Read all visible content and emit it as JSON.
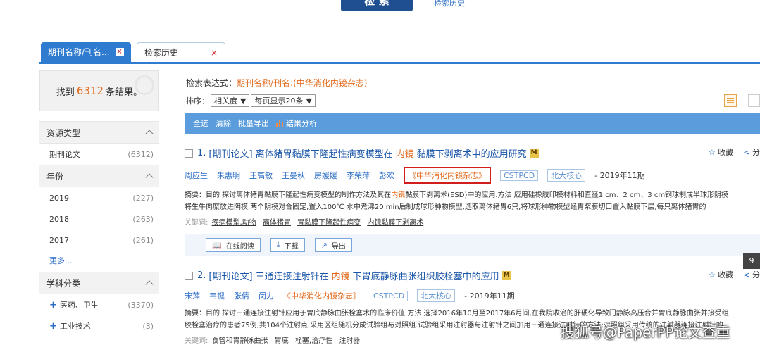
{
  "top": {
    "search_button": "检 索",
    "history_link": "检索历史"
  },
  "tabs": [
    {
      "label": "期刊名称/刊名...",
      "close": "×"
    },
    {
      "label": "检索历史",
      "close": "×"
    }
  ],
  "sidebar": {
    "found_prefix": "找到",
    "found_count": "6312",
    "found_suffix": "条结果。",
    "facets": {
      "resource": {
        "title": "资源类型",
        "items": [
          {
            "label": "期刊论文",
            "count": "(6312)"
          }
        ]
      },
      "year": {
        "title": "年份",
        "items": [
          {
            "label": "2019",
            "count": "(227)"
          },
          {
            "label": "2018",
            "count": "(263)"
          },
          {
            "label": "2017",
            "count": "(261)"
          }
        ],
        "more": "更多..."
      },
      "subject": {
        "title": "学科分类",
        "items": [
          {
            "label": "医药、卫生",
            "count": "(3370)"
          },
          {
            "label": "工业技术",
            "count": "(3)"
          }
        ]
      }
    }
  },
  "main": {
    "query_label": "检索表达式：",
    "query_value": "期刊名称/刊名:(中华消化内镜杂志)",
    "sort_label": "排序：",
    "sort_value": "相关度",
    "page_size_value": "每页显示20条",
    "toolbar": {
      "select_all": "全选",
      "clear": "清除",
      "batch_export": "批量导出",
      "analysis": "结果分析"
    },
    "actions": {
      "favorite": "收藏",
      "share": "分"
    },
    "buttons": {
      "read": "在线阅读",
      "download": "下载",
      "export": "导出"
    },
    "keywords_label": "关键词:",
    "records": [
      {
        "index": "1.",
        "type": "[期刊论文]",
        "title_a": "离体猪胃黏膜下隆起性病变模型在",
        "title_hl": "内镜",
        "title_b": "黏膜下剥离术中的应用研究",
        "badge": "M",
        "authors": [
          "周应生",
          "朱惠明",
          "王高敏",
          "王曼秋",
          "房媛媛",
          "李荣萍",
          "彭欢"
        ],
        "journal": "《中华消化内镜杂志》",
        "tags": [
          "CSTPCD",
          "北大核心"
        ],
        "date": "- 2019年11期",
        "abstract_a": "摘要：目的  探讨离体猪胃黏膜下隆起性病变模型的制作方法及其在",
        "abstract_hl": "内镜",
        "abstract_b": "黏膜下剥离术(ESD)中的应用.方法  应用硅橡胶印模材料和直径1 cm、2 cm、3 cm钢球制成半球形阴模",
        "abstract_line2": "将生牛肉糜放进阴模,两个阴模对合固定,置入100℃ 水中煮沸20 min后制成球形肿物模型,选取离体猪胃6只,将球形肿物模型经胃浆膜切口置入黏膜下层,每只离体猪胃的",
        "keywords": [
          "疾病模型,动物",
          "离体猪胃",
          "胃黏膜下隆起性病变",
          "内镜黏膜下剥离术"
        ]
      },
      {
        "index": "2.",
        "type": "[期刊论文]",
        "title_a": "三通连接注射针在",
        "title_hl": "内镜",
        "title_b": "下胃底静脉曲张组织胶栓塞中的应用",
        "badge": "M",
        "authors": [
          "宋萍",
          "韦键",
          "张倩",
          "闵力"
        ],
        "journal": "《中华消化内镜杂志》",
        "tags": [
          "CSTPCD",
          "北大核心"
        ],
        "date": "- 2019年11期",
        "abstract_a": "摘要：目的  探讨三通连接注射针应用于胃底静脉曲张栓塞术的临床价值.方法  选择2016年10月至2017年6月间,在我院收治的肝硬化导致门静脉高压合并胃底静脉曲张并接受组",
        "abstract_line2": "胶栓塞治疗的患者75例,共104个注射点,采用区组随机分成试验组与对照组.试验组采用注射器与注射针之间加用三通连接注射针的方法;对照组采用传统的注射器连接注射针的",
        "keywords": [
          "食管和胃静脉曲张",
          "胃底",
          "栓塞,治疗性",
          "注射器"
        ]
      }
    ]
  },
  "side_tab": "9",
  "watermark": "搜狐号@PaperPP论文查重"
}
